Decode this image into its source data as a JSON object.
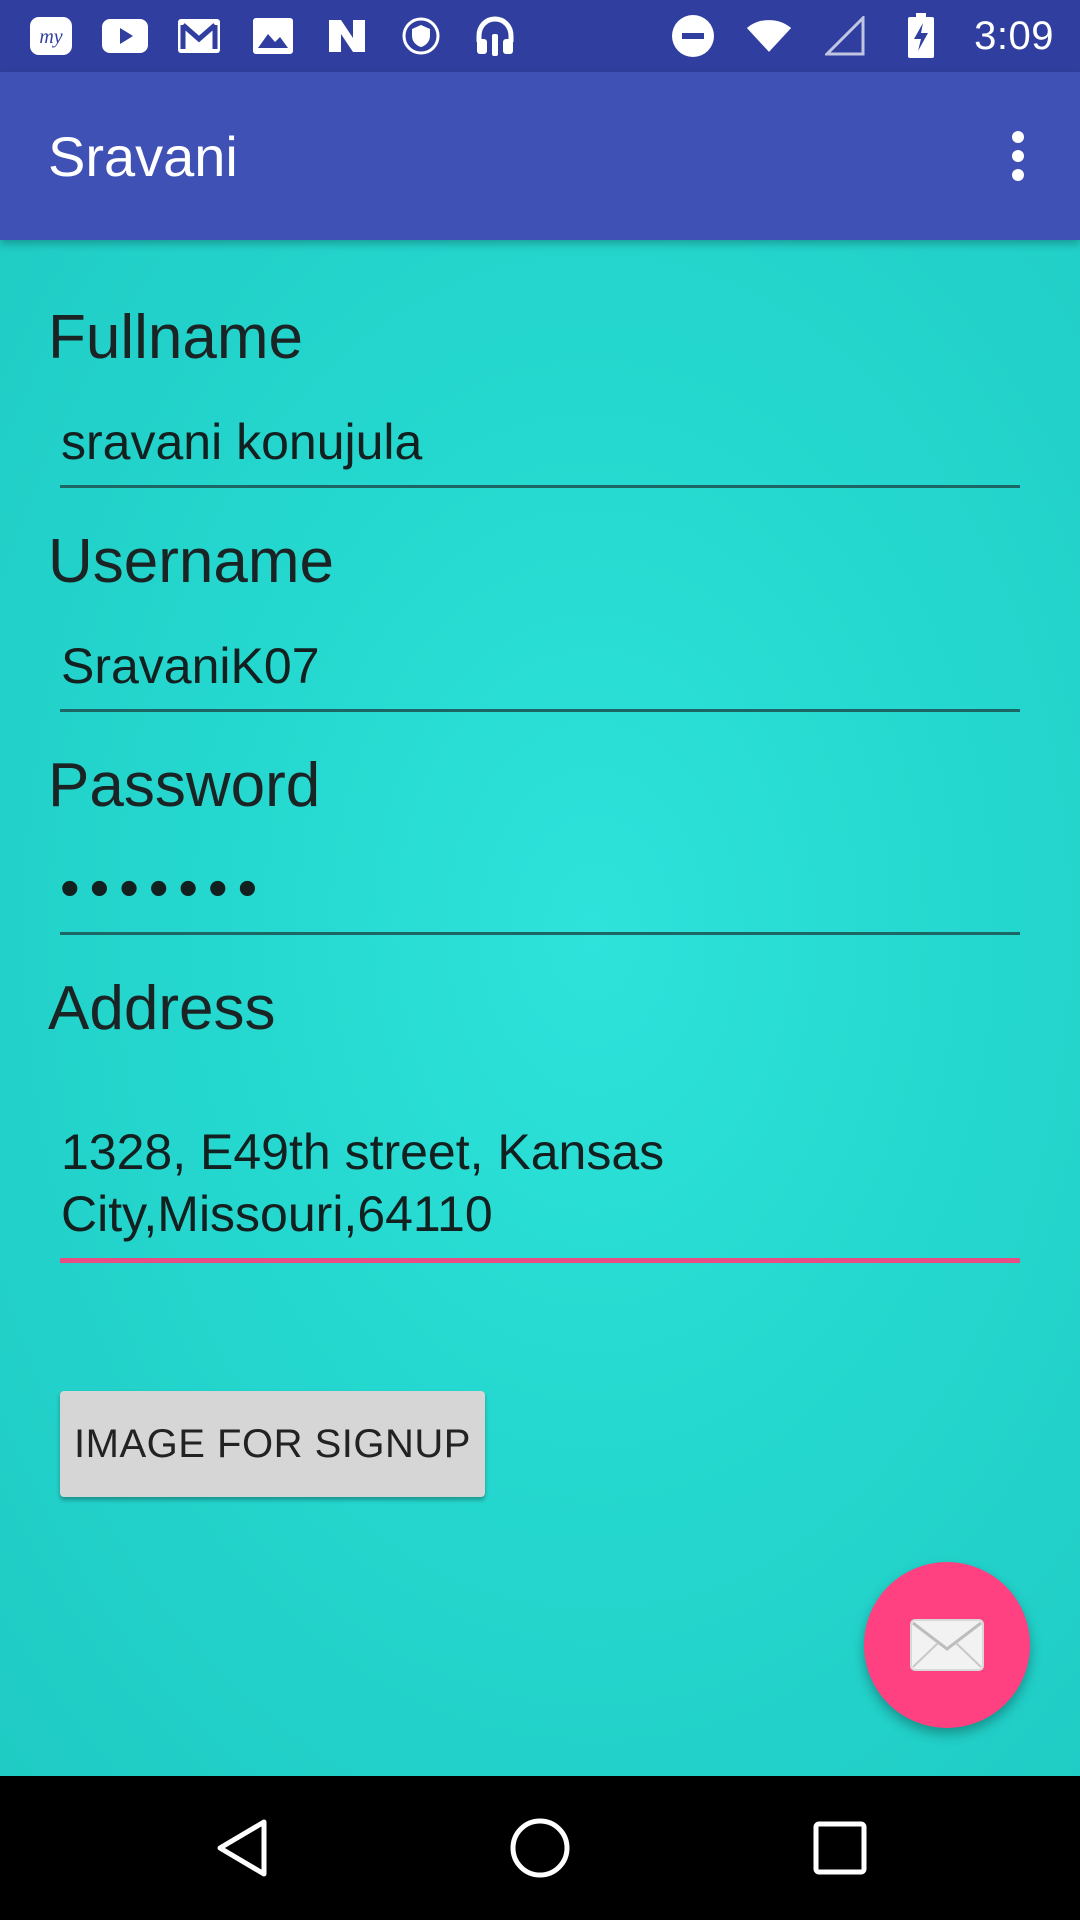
{
  "status_bar": {
    "time": "3:09",
    "left_icons": [
      "my-app-icon",
      "youtube-icon",
      "gmail-icon",
      "photos-icon",
      "n-app-icon",
      "shield-icon",
      "headphones-icon"
    ],
    "right_icons": [
      "do-not-disturb-icon",
      "wifi-icon",
      "signal-icon",
      "battery-charging-icon"
    ]
  },
  "app_bar": {
    "title": "Sravani",
    "overflow_icon": "more-vert-icon"
  },
  "form": {
    "fullname": {
      "label": "Fullname",
      "value": "sravani konujula"
    },
    "username": {
      "label": "Username",
      "value": "SravaniK07"
    },
    "password": {
      "label": "Password",
      "value": "•••••••"
    },
    "address": {
      "label": "Address",
      "line1": "1328, E49th street, Kansas",
      "line2": "City,Missouri,64110"
    }
  },
  "signup_button": {
    "label": "IMAGE FOR SIGNUP"
  },
  "fab": {
    "icon": "mail-icon"
  },
  "colors": {
    "status_bar": "#303f9f",
    "app_bar": "#3f51b5",
    "background": "#25d8cf",
    "accent": "#ff4081"
  },
  "nav_bar": {
    "icons": [
      "back-icon",
      "home-icon",
      "recents-icon"
    ]
  }
}
